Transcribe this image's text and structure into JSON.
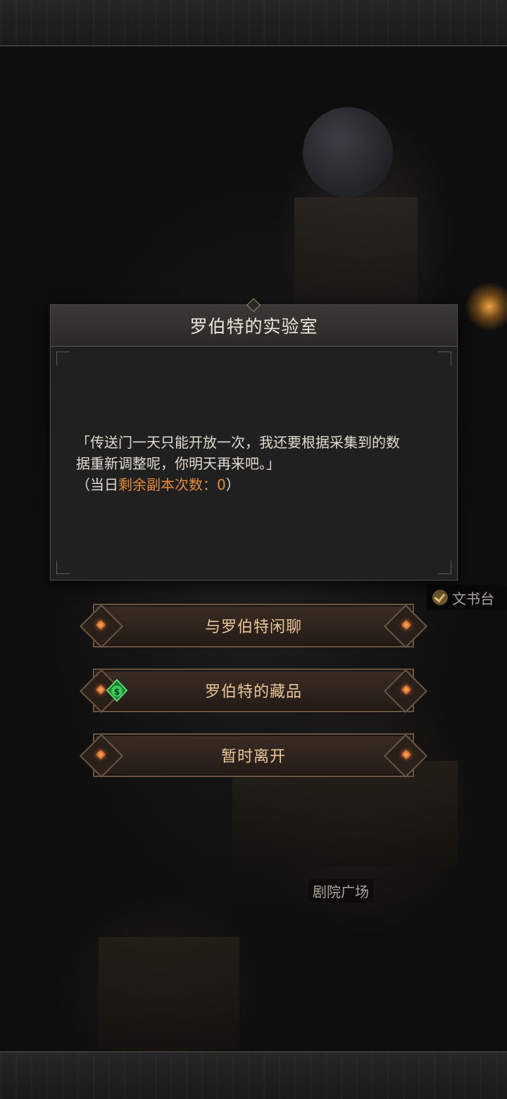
{
  "dialog": {
    "title": "罗伯特的实验室",
    "line1": "「传送门一天只能开放一次，我还要根据采集到的数",
    "line2": "据重新调整呢，你明天再来吧。」",
    "note_prefix": "（当日",
    "note_highlight": "剩余副本次数：0",
    "note_suffix": "）"
  },
  "options": [
    {
      "label": "与罗伯特闲聊",
      "icon": null
    },
    {
      "label": "罗伯特的藏品",
      "icon": "money-bag-icon"
    },
    {
      "label": "暂时离开",
      "icon": null
    }
  ],
  "map_labels": {
    "desk": "文书台",
    "plaza": "剧院广场"
  },
  "colors": {
    "highlight": "#e28a3a",
    "button_text": "#e8c79a",
    "money_icon": "#2fb84a"
  }
}
